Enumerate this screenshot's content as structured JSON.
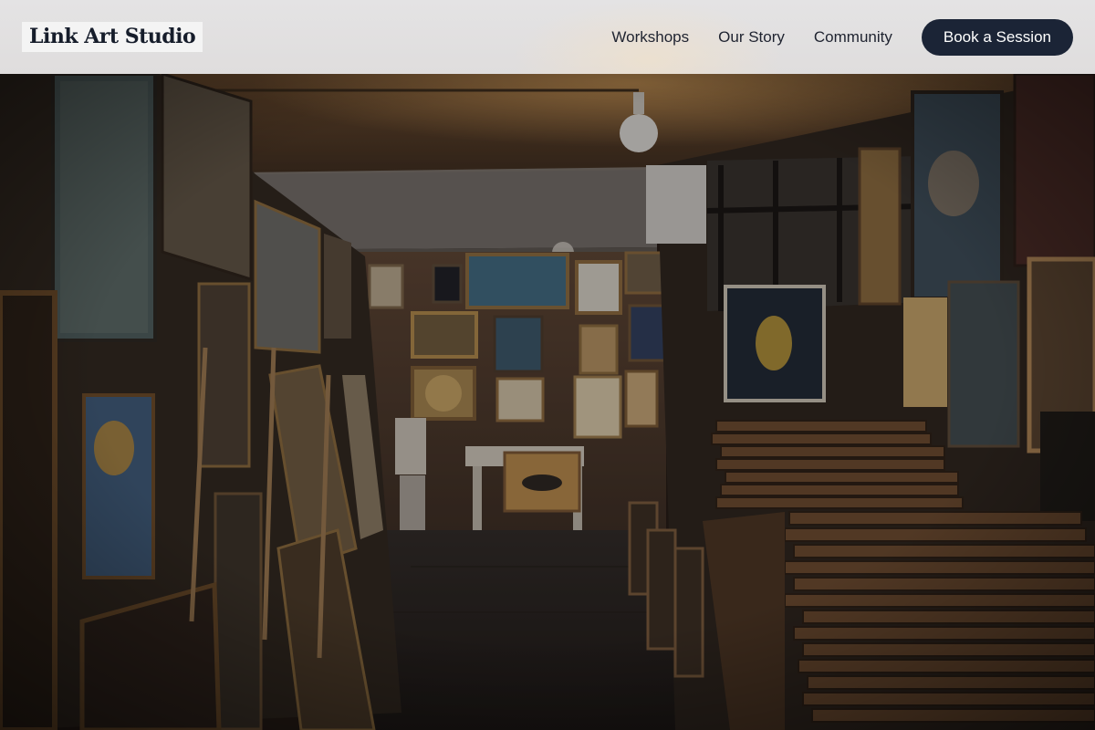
{
  "header": {
    "logo": "Link Art Studio",
    "nav": [
      {
        "label": "Workshops"
      },
      {
        "label": "Our Story"
      },
      {
        "label": "Community"
      }
    ],
    "cta_label": "Book a Session"
  },
  "hero": {
    "image_icon": "art-gallery-photo"
  },
  "colors": {
    "header_bg": "#e2e1e2",
    "cta_bg": "#1b2436",
    "text_dark": "#1f2330"
  }
}
